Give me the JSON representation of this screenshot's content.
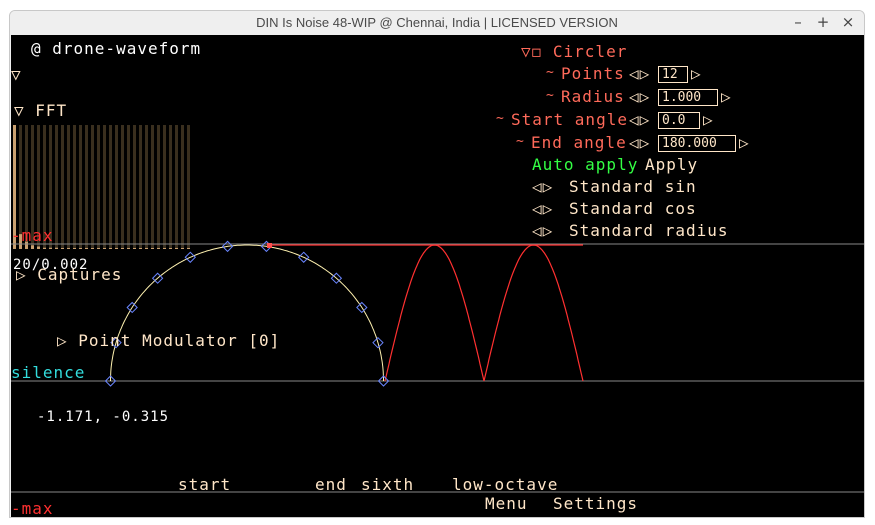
{
  "window": {
    "title": "DIN Is Noise 48-WIP @ Chennai, India | LICENSED VERSION",
    "minimize_glyph": "–",
    "maximize_glyph": "+",
    "close_glyph": "×"
  },
  "left_panel": {
    "waveform_label": "@ drone-waveform",
    "collapse_toggle": "▽",
    "fft_label": "▽ FFT",
    "max_label_top": "-max",
    "value_readout": "20/0.002",
    "captures_label": "▷ Captures",
    "point_modulator_label": "▷ Point Modulator [0]",
    "silence_label": "silence",
    "cursor_readout": "-1.171, -0.315",
    "max_label_bottom": "-max"
  },
  "circler": {
    "header_label": "▽◻ Circler",
    "points": {
      "tilde": "~",
      "label": "Points",
      "arrows": "◁▷",
      "value": "12",
      "next": "▷"
    },
    "radius": {
      "tilde": "~",
      "label": "Radius",
      "arrows": "◁▷",
      "value": "1.000",
      "next": "▷"
    },
    "start_angle": {
      "tilde": "~",
      "label": "Start angle",
      "arrows": "◁▷",
      "value": "0.0",
      "next": "▷"
    },
    "end_angle": {
      "tilde": "~",
      "label": "End angle",
      "arrows": "◁▷",
      "value": "180.000",
      "next": "▷"
    },
    "auto_apply_label": "Auto apply",
    "apply_label": "Apply",
    "standard_sin": {
      "arrows": "◁▷",
      "label": "Standard sin"
    },
    "standard_cos": {
      "arrows": "◁▷",
      "label": "Standard cos"
    },
    "standard_radius": {
      "arrows": "◁▷",
      "label": "Standard radius"
    }
  },
  "bottom_bar": {
    "start_label": "start",
    "end_label": "end",
    "sixth_label": "sixth",
    "low_octave_label": "low-octave",
    "menu_label": "Menu",
    "settings_label": "Settings"
  },
  "fft": {
    "bar_levels": [
      1.0,
      0.12,
      0.06,
      0.03,
      0.02,
      0.01,
      0.01,
      0.01,
      0.0,
      0.0,
      0.0,
      0.0,
      0.0,
      0.0,
      0.0,
      0.0,
      0.0,
      0.0,
      0.0,
      0.0,
      0.0,
      0.0,
      0.0,
      0.0,
      0.0,
      0.0,
      0.0,
      0.0,
      0.0,
      0.0
    ]
  },
  "colors": {
    "background": "#000000",
    "label_salmon": "#ff6a5a",
    "text_beige": "#ffe6c8",
    "accent_green": "#33ff44",
    "silence_cyan": "#33dddd",
    "waveform_red": "#ff3030",
    "control_point_blue": "#6a86ff"
  }
}
